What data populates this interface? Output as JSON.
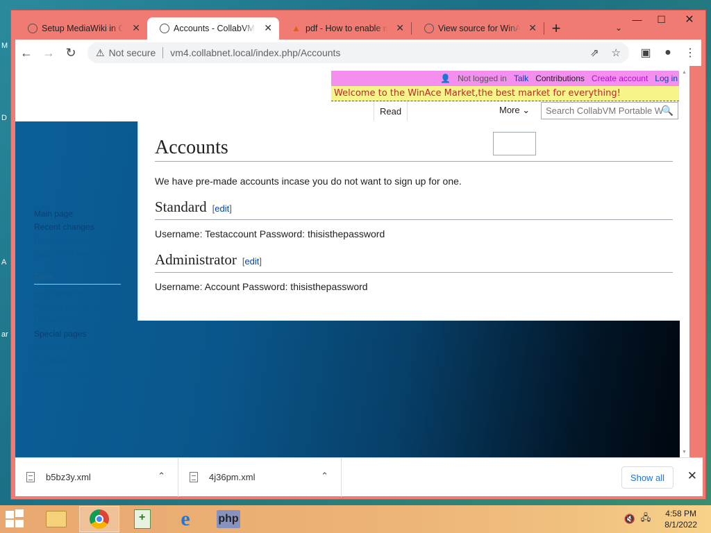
{
  "desktop": {
    "labels": [
      "M",
      "D",
      "A",
      "ar"
    ]
  },
  "window": {
    "controls": {
      "minimize": "—",
      "maximize": "☐",
      "close": "✕"
    }
  },
  "tabs": [
    {
      "title": "Setup MediaWiki in CollabVM",
      "close": "✕",
      "favicon": "globe-icon"
    },
    {
      "title": "Accounts - CollabVM Portable",
      "close": "✕",
      "favicon": "globe-icon",
      "active": true
    },
    {
      "title": "pdf - How to enable mime types",
      "close": "✕",
      "favicon": "pdf-icon"
    },
    {
      "title": "View source for WinAce Market",
      "close": "✕",
      "favicon": "globe-icon"
    }
  ],
  "newtab": "+",
  "tab_menu": "⌄",
  "toolbar": {
    "back": "←",
    "forward": "→",
    "reload": "↻",
    "not_secure": "Not secure",
    "warn_icon": "⚠",
    "url_host": "vm4.collabnet.local",
    "url_path": "/index.php/Accounts",
    "share": "⇗",
    "star": "☆",
    "sidepanel": "▣",
    "profile": "●",
    "menu": "⋮"
  },
  "wiki": {
    "personal": {
      "user_icon": "👤",
      "not_logged_in": "Not logged in",
      "talk": "Talk",
      "contributions": "Contributions",
      "create_account": "Create account",
      "log_in": "Log in"
    },
    "sitenotice": "Welcome to the WinAce Market,the best market for everything!",
    "tab_read": "Read",
    "more": "More ⌄",
    "search_placeholder": "Search CollabVM Portable W",
    "search_icon": "🔍",
    "page_title": "Accounts",
    "intro": "We have pre-made accounts incase you do not want to sign up for one.",
    "sections": [
      {
        "heading": "Standard",
        "edit": "edit",
        "text": "Username: Testaccount Password: thisisthepassword"
      },
      {
        "heading": "Administrator",
        "edit": "edit",
        "text": "Username: Account Password: thisisthepassword"
      }
    ],
    "sidebar": {
      "nav": [
        "Main page",
        "Recent changes",
        "Random page",
        "Help about MediaWiki"
      ],
      "tools_heading": "Tools",
      "tools": [
        "What links here",
        "Related changes",
        "Upload file",
        "Special pages",
        "Printable version",
        "Permanent link",
        "Page information"
      ]
    }
  },
  "downloads": [
    {
      "name": "b5bz3y.xml",
      "chevron": "⌃"
    },
    {
      "name": "4j36pm.xml",
      "chevron": "⌃"
    }
  ],
  "download_showall": "Show all",
  "download_close": "✕",
  "taskbar": {
    "time": "4:58 PM",
    "date": "8/1/2022",
    "php_label": "php",
    "ie_label": "e",
    "volume_icon": "🔇",
    "network_icon": "🖧"
  }
}
